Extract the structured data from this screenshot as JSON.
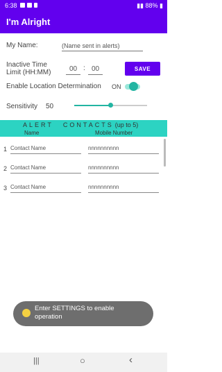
{
  "status_bar": {
    "time": "6:38",
    "battery": "88%"
  },
  "app": {
    "title": "I'm Alright"
  },
  "form": {
    "name_label": "My Name:",
    "name_placeholder": "(Name sent in alerts)",
    "inactive_label_1": "Inactive Time",
    "inactive_label_2": "Limit (HH:MM)",
    "hours": "00",
    "minutes": "00",
    "separator": ":",
    "save_label": "SAVE",
    "location_label": "Enable Location Determination",
    "location_state": "ON",
    "sensitivity_label": "Sensitivity",
    "sensitivity_value": "50",
    "sensitivity_fraction": 0.5
  },
  "contacts": {
    "title_part1": "ALERT",
    "title_part2": "CONTACTS",
    "title_part3": "(up to 5)",
    "col_name": "Name",
    "col_mobile": "Mobile Number",
    "rows": [
      {
        "num": "1",
        "name": "Contact Name",
        "mobile": "nnnnnnnnnn"
      },
      {
        "num": "2",
        "name": "Contact Name",
        "mobile": "nnnnnnnnnn"
      },
      {
        "num": "3",
        "name": "Contact Name",
        "mobile": "nnnnnnnnnn"
      }
    ]
  },
  "toast": {
    "line1": "Enter SETTINGS to enable",
    "line2": "operation"
  },
  "nav": {
    "recents": "|||",
    "home": "○",
    "back": "‹"
  },
  "colors": {
    "primary": "#6200ee",
    "accent": "#22b5a2",
    "header_bg": "#2cd3c2"
  }
}
